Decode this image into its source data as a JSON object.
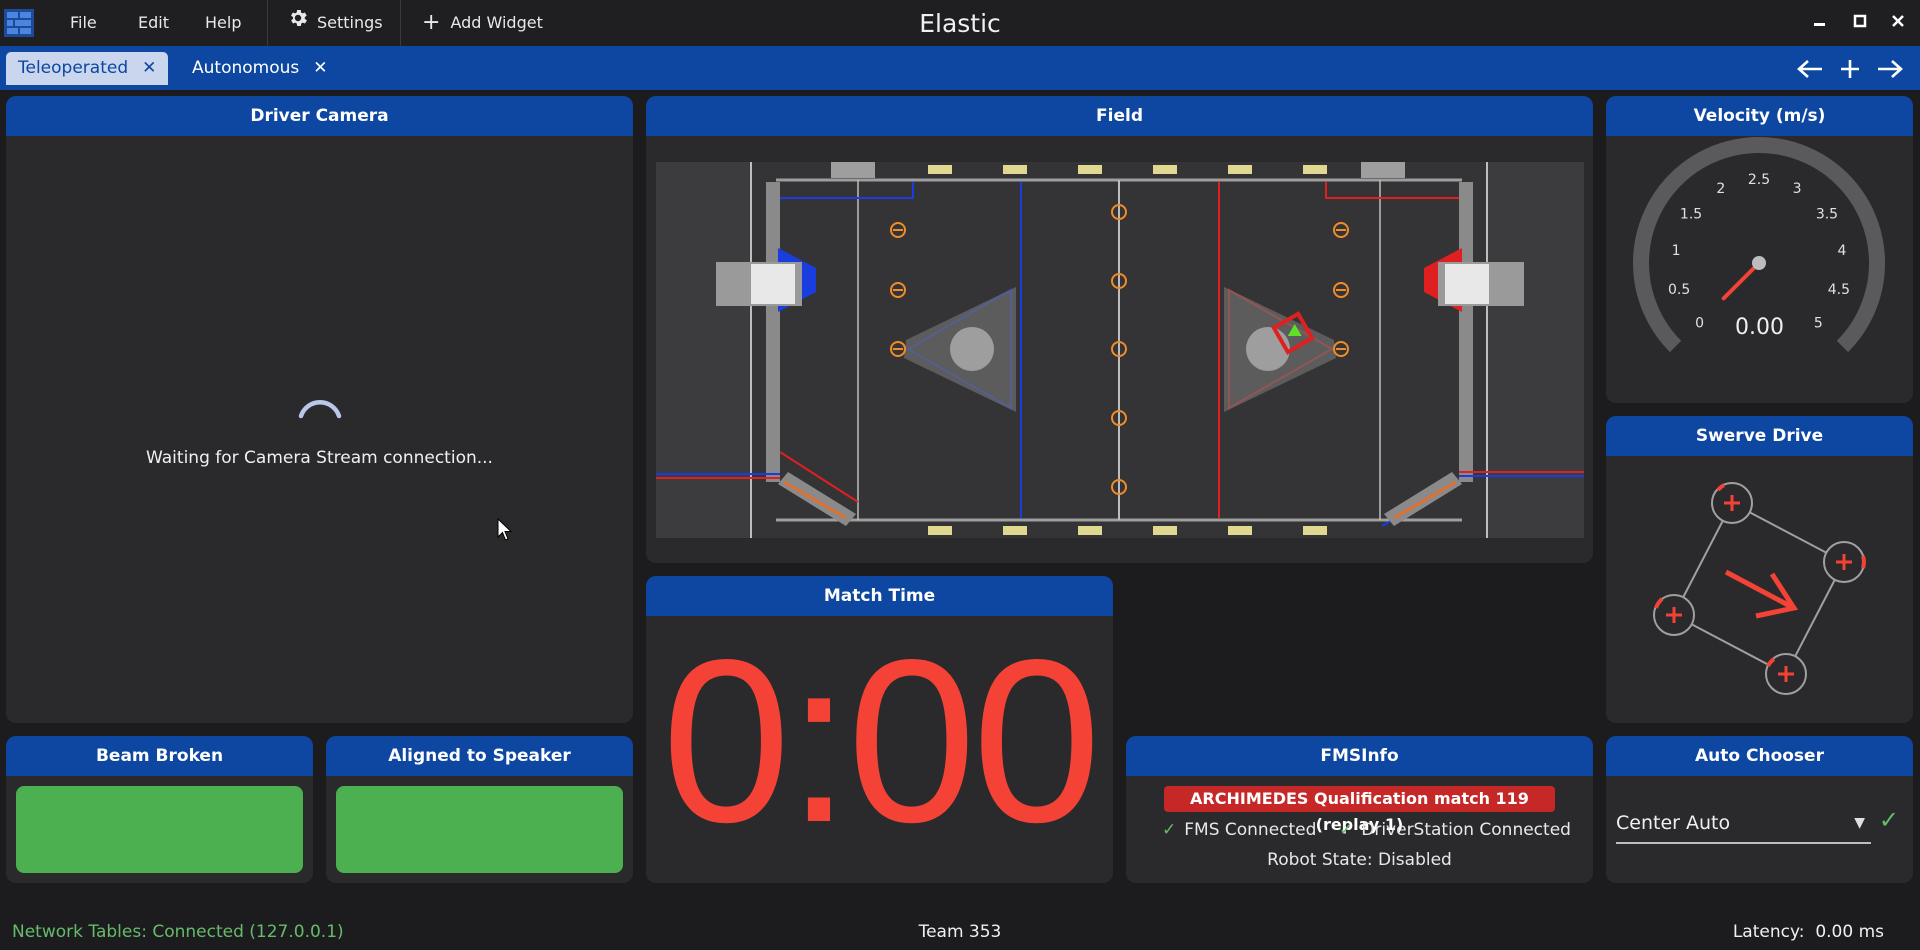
{
  "app": {
    "title": "Elastic",
    "menu": {
      "file": "File",
      "edit": "Edit",
      "help": "Help",
      "settings": "Settings",
      "add_widget": "Add Widget"
    }
  },
  "tabs": [
    {
      "label": "Teleoperated",
      "active": true
    },
    {
      "label": "Autonomous",
      "active": false
    }
  ],
  "tab_close_glyph": "✕",
  "widgets": {
    "driver_camera": {
      "title": "Driver Camera",
      "status": "Waiting for Camera Stream connection..."
    },
    "field": {
      "title": "Field"
    },
    "velocity": {
      "title": "Velocity (m/s)",
      "value": "0.00",
      "value_num": 0,
      "min": 0,
      "max": 5,
      "ticks": [
        "0",
        "0.5",
        "1",
        "1.5",
        "2",
        "2.5",
        "3",
        "3.5",
        "4",
        "4.5",
        "5"
      ]
    },
    "swerve": {
      "title": "Swerve Drive"
    },
    "match_time": {
      "title": "Match Time",
      "value": "0:00"
    },
    "beam_broken": {
      "title": "Beam Broken",
      "state": true,
      "color": "#4caf50"
    },
    "aligned": {
      "title": "Aligned to Speaker",
      "state": true,
      "color": "#4caf50"
    },
    "fms": {
      "title": "FMSInfo",
      "event": "ARCHIMEDES Qualification match 119 (replay 1)",
      "fms_connected": "FMS Connected",
      "ds_connected": "DriverStation Connected",
      "robot_state": "Robot State: Disabled"
    },
    "auto_chooser": {
      "title": "Auto Chooser",
      "selected": "Center Auto"
    }
  },
  "status": {
    "network_tables": "Network Tables: Connected (127.0.0.1)",
    "team": "Team 353",
    "latency": "Latency:  0.00 ms"
  },
  "colors": {
    "accent": "#0d47a1",
    "card": "#2a2a2c",
    "background": "#1c1c1e",
    "alert_red": "#f44336",
    "ok_green": "#4caf50"
  }
}
